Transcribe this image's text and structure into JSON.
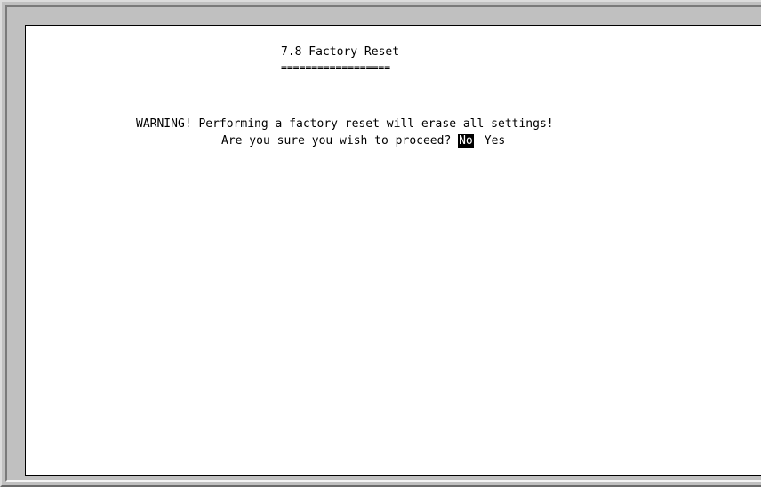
{
  "screen": {
    "title": "7.8 Factory Reset",
    "title_underline": "==================",
    "warning": "WARNING! Performing a factory reset will erase all settings!",
    "prompt": "Are you sure you wish to proceed?",
    "options": [
      {
        "label": "No",
        "selected": true
      },
      {
        "label": "Yes",
        "selected": false
      }
    ]
  },
  "colors": {
    "background": "#ffffff",
    "text": "#000000",
    "selection_background": "#000000",
    "selection_text": "#ffffff",
    "frame": "#c0c0c0"
  }
}
